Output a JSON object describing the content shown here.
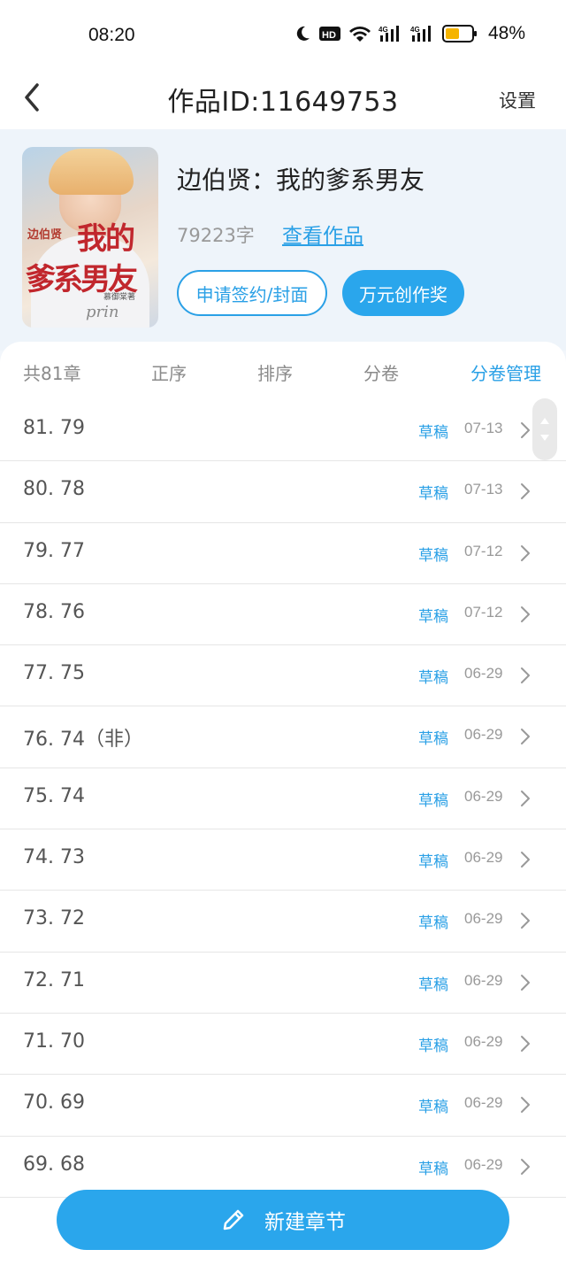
{
  "status_bar": {
    "time": "08:20",
    "battery": "48%",
    "icons": [
      "moon-icon",
      "hd-icon",
      "wifi-icon",
      "signal-4g-icon",
      "signal-4g-icon",
      "battery-icon"
    ]
  },
  "header": {
    "title": "作品ID:11649753",
    "settings_label": "设置"
  },
  "book": {
    "title": "边伯贤：我的爹系男友",
    "word_count": "79223字",
    "view_link": "查看作品",
    "sign_button": "申请签约/封面",
    "award_button": "万元创作奖",
    "cover_text": {
      "small": "边伯贤",
      "big1": "我的",
      "big2": "爹系男友",
      "author": "慕御棠著",
      "deco": "prin"
    }
  },
  "toolbar": {
    "count": "共81章",
    "order": "正序",
    "sort": "排序",
    "volume": "分卷",
    "volume_manage": "分卷管理"
  },
  "chapters": [
    {
      "title": "81. 79",
      "status": "草稿",
      "date": "07-13"
    },
    {
      "title": "80. 78",
      "status": "草稿",
      "date": "07-13"
    },
    {
      "title": "79. 77",
      "status": "草稿",
      "date": "07-12"
    },
    {
      "title": "78. 76",
      "status": "草稿",
      "date": "07-12"
    },
    {
      "title": "77. 75",
      "status": "草稿",
      "date": "06-29"
    },
    {
      "title": "76. 74（非）",
      "status": "草稿",
      "date": "06-29"
    },
    {
      "title": "75. 74",
      "status": "草稿",
      "date": "06-29"
    },
    {
      "title": "74. 73",
      "status": "草稿",
      "date": "06-29"
    },
    {
      "title": "73. 72",
      "status": "草稿",
      "date": "06-29"
    },
    {
      "title": "72. 71",
      "status": "草稿",
      "date": "06-29"
    },
    {
      "title": "71. 70",
      "status": "草稿",
      "date": "06-29"
    },
    {
      "title": "70. 69",
      "status": "草稿",
      "date": "06-29"
    },
    {
      "title": "69. 68",
      "status": "草稿",
      "date": "06-29"
    }
  ],
  "new_chapter_button": "新建章节",
  "colors": {
    "accent": "#2aa6ec",
    "link": "#2aa0e6",
    "background": "#f2f6fb"
  }
}
